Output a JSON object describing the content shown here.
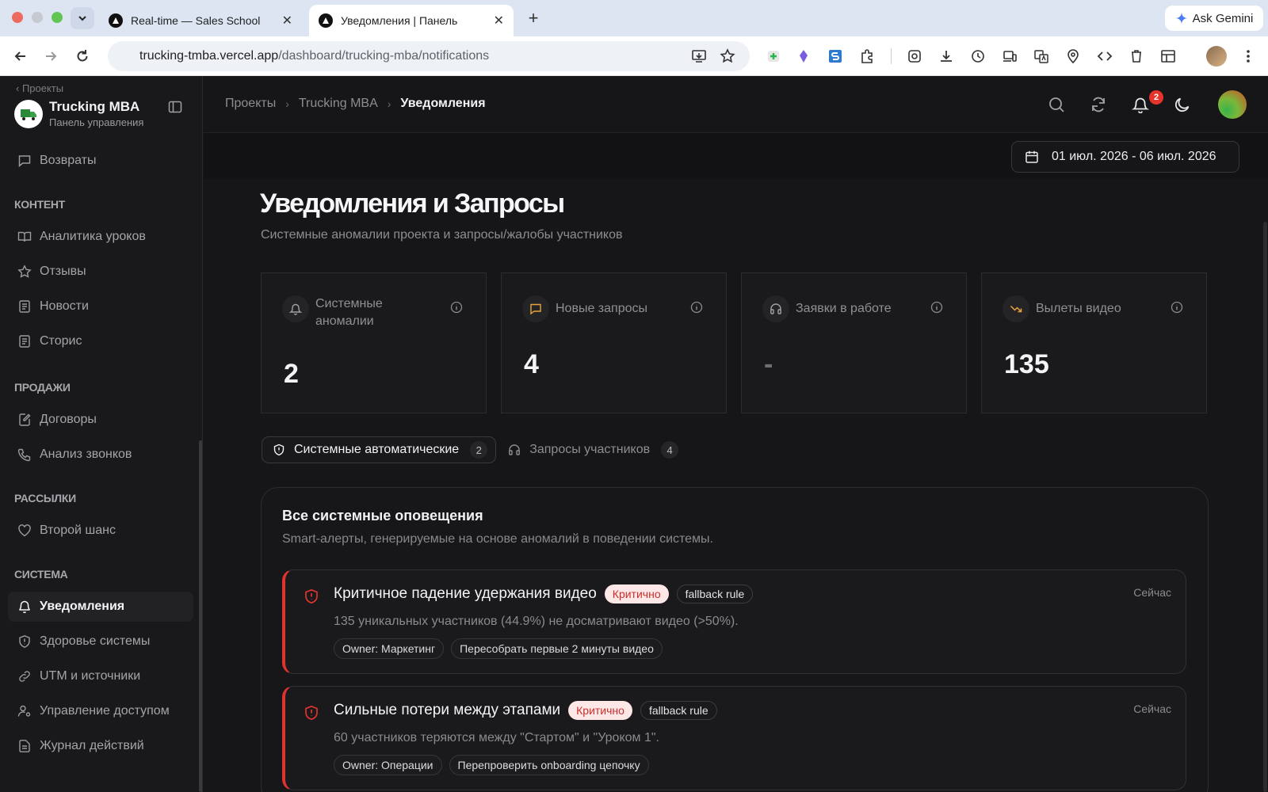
{
  "browser": {
    "tabs": [
      {
        "title": "Real-time — Sales School",
        "active": false
      },
      {
        "title": "Уведомления | Панель",
        "active": true
      }
    ],
    "new_tab": "+",
    "ask_gemini": "Ask Gemini",
    "url_host": "trucking-tmba.vercel.app",
    "url_path": "/dashboard/trucking-mba/notifications",
    "close_glyph": "✕"
  },
  "sidebar": {
    "back_label": "‹ Проекты",
    "project_title": "Trucking MBA",
    "project_subtitle": "Панель управления",
    "top_item": {
      "label": "Возвраты",
      "icon": "message-square-icon"
    },
    "sections": {
      "content": "КОНТЕНТ",
      "sales": "ПРОДАЖИ",
      "mailings": "РАССЫЛКИ",
      "system": "СИСТЕМА"
    },
    "items": {
      "lesson_analytics": "Аналитика уроков",
      "reviews": "Отзывы",
      "news": "Новости",
      "stories": "Сторис",
      "contracts": "Договоры",
      "calls": "Анализ звонков",
      "second_chance": "Второй шанс",
      "notifications": "Уведомления",
      "health": "Здоровье системы",
      "utm": "UTM и источники",
      "access": "Управление доступом",
      "journal": "Журнал действий"
    }
  },
  "header": {
    "breadcrumbs": [
      "Проекты",
      "Trucking MBA",
      "Уведомления"
    ],
    "notification_count": "2",
    "date_range": "01 июл. 2026 - 06 июл. 2026"
  },
  "page": {
    "title": "Уведомления и Запросы",
    "subtitle": "Системные аномалии проекта и запросы/жалобы участников"
  },
  "stats": [
    {
      "label": "Системные аномалии",
      "value": "2",
      "icon": "bell-icon",
      "accent": "#a0a0a6"
    },
    {
      "label": "Новые запросы",
      "value": "4",
      "icon": "message-square-icon",
      "accent": "#e8a43a"
    },
    {
      "label": "Заявки в работе",
      "value": "-",
      "icon": "headphones-icon",
      "accent": "#a0a0a6"
    },
    {
      "label": "Вылеты видео",
      "value": "135",
      "icon": "trending-down-icon",
      "accent": "#e8a43a"
    }
  ],
  "tabs": [
    {
      "label": "Системные автоматические",
      "count": "2",
      "active": true,
      "icon": "shield-icon"
    },
    {
      "label": "Запросы участников",
      "count": "4",
      "active": false,
      "icon": "headphones-icon"
    }
  ],
  "panel": {
    "title": "Все системные оповещения",
    "subtitle": "Smart-алерты, генерируемые на основе аномалий в поведении системы."
  },
  "alerts": [
    {
      "title": "Критичное падение удержания видео",
      "severity": "Критично",
      "rule": "fallback rule",
      "description": "135 уникальных участников (44.9%) не досматривают видео (>50%).",
      "owner": "Owner: Маркетинг",
      "action": "Пересобрать первые 2 минуты видео",
      "time": "Сейчас"
    },
    {
      "title": "Сильные потери между этапами",
      "severity": "Критично",
      "rule": "fallback rule",
      "description": "60 участников теряются между \"Стартом\" и \"Уроком 1\".",
      "owner": "Owner: Операции",
      "action": "Перепроверить onboarding цепочку",
      "time": "Сейчас"
    }
  ],
  "colors": {
    "critical": "#e0332f",
    "accent_orange": "#e8a43a",
    "background": "#161618"
  }
}
